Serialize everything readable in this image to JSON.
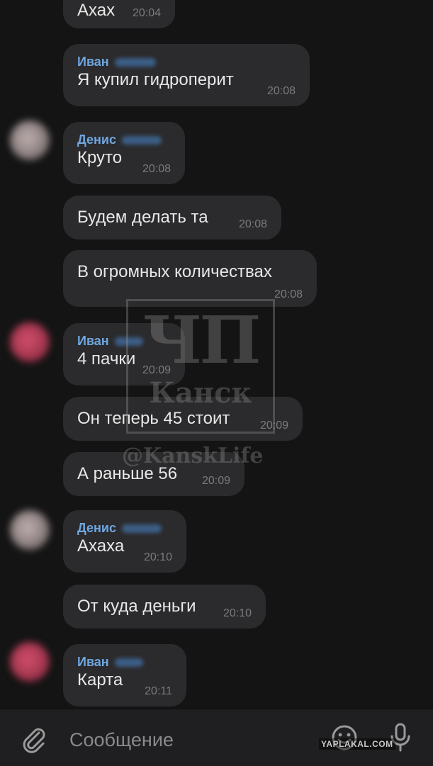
{
  "messages": [
    {
      "sender": "",
      "text": "Ахах",
      "time": "20:04"
    },
    {
      "sender": "Иван",
      "text": "Я купил гидроперит",
      "time": "20:08"
    },
    {
      "sender": "Денис",
      "text": "Круто",
      "time": "20:08"
    },
    {
      "sender": "",
      "text": "Будем делать та",
      "time": "20:08"
    },
    {
      "sender": "",
      "text": "В огромных количествах",
      "time": "20:08"
    },
    {
      "sender": "Иван",
      "text": "4 пачки",
      "time": "20:09"
    },
    {
      "sender": "",
      "text": "Он теперь 45 стоит",
      "time": "20:09"
    },
    {
      "sender": "",
      "text": "А раньше 56",
      "time": "20:09"
    },
    {
      "sender": "Денис",
      "text": "Ахаха",
      "time": "20:10"
    },
    {
      "sender": "",
      "text": "От куда деньги",
      "time": "20:10"
    },
    {
      "sender": "Иван",
      "text": "Карта",
      "time": "20:11"
    }
  ],
  "watermark": {
    "title": "ЧП",
    "city": "Канск",
    "handle": "@KanskLife"
  },
  "composer": {
    "placeholder": "Сообщение"
  },
  "site_watermark": "YAPLAKAL.COM",
  "icons": {
    "attach": "paperclip-icon",
    "emoji": "emoji-icon",
    "mic": "microphone-icon"
  },
  "colors": {
    "background": "#141414",
    "bubble": "#2b2b2d",
    "sender": "#6fa6e0",
    "time": "#7b7b7b"
  }
}
